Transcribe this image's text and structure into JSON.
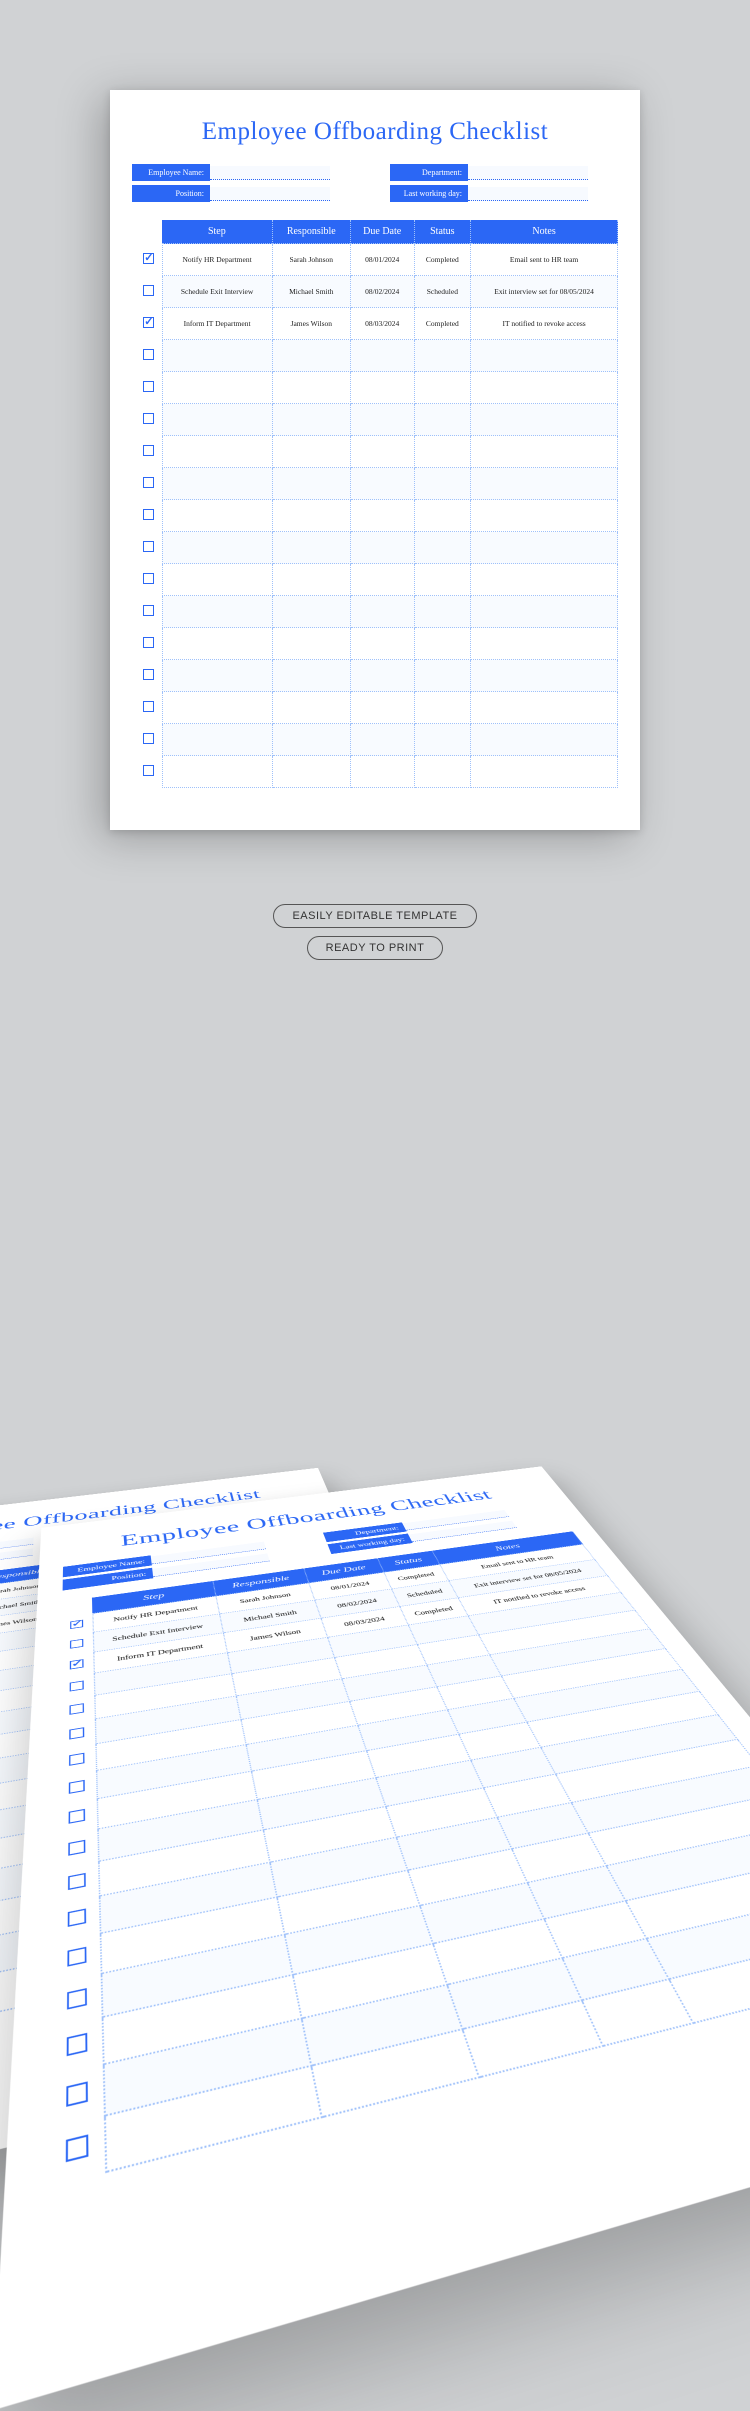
{
  "title": "Employee Offboarding Checklist",
  "fields": {
    "left": [
      {
        "label": "Employee Name:"
      },
      {
        "label": "Position:"
      }
    ],
    "right": [
      {
        "label": "Department:"
      },
      {
        "label": "Last working day:"
      }
    ]
  },
  "columns": [
    "Step",
    "Responsible",
    "Due Date",
    "Status",
    "Notes"
  ],
  "rows": [
    {
      "checked": true,
      "step": "Notify HR Department",
      "responsible": "Sarah Johnson",
      "due": "08/01/2024",
      "status": "Completed",
      "notes": "Email sent to HR team"
    },
    {
      "checked": false,
      "step": "Schedule Exit Interview",
      "responsible": "Michael Smith",
      "due": "08/02/2024",
      "status": "Scheduled",
      "notes": "Exit interview set for 08/05/2024"
    },
    {
      "checked": true,
      "step": "Inform IT Department",
      "responsible": "James Wilson",
      "due": "08/03/2024",
      "status": "Completed",
      "notes": "IT notified to revoke access"
    }
  ],
  "emptyRows": 14,
  "badges": [
    "EASILY EDITABLE TEMPLATE",
    "READY TO PRINT"
  ],
  "colors": {
    "accent": "#2b67f5"
  }
}
